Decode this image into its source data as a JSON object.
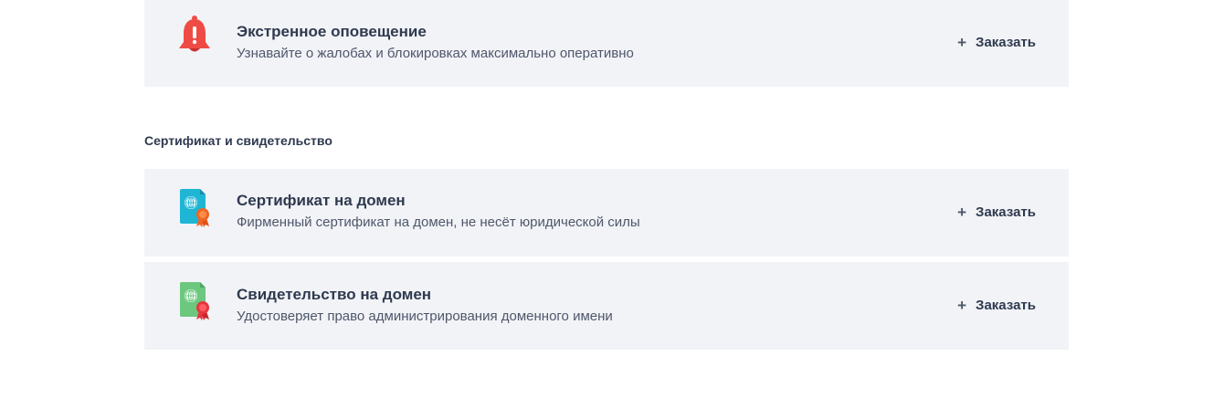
{
  "cards": [
    {
      "title": "Экстренное оповещение",
      "description": "Узнавайте о жалобах и блокировках максимально оперативно",
      "action_icon": "+",
      "action_label": "Заказать",
      "icon": "bell-alert-icon"
    }
  ],
  "section": {
    "title": "Сертификат и свидетельство",
    "items": [
      {
        "title": "Сертификат на домен",
        "description": "Фирменный сертификат на домен, не несёт юридической силы",
        "action_icon": "+",
        "action_label": "Заказать",
        "icon": "domain-certificate-icon"
      },
      {
        "title": "Свидетельство на домен",
        "description": "Удостоверяет право администрирования доменного имени",
        "action_icon": "+",
        "action_label": "Заказать",
        "icon": "domain-testimony-icon"
      }
    ]
  },
  "colors": {
    "card_bg": "#f2f3f7",
    "text": "#2f3a4f",
    "bell": "#ef4b45",
    "cert_blue": "#1eb6d4",
    "cert_green": "#6cc77f",
    "seal_orange": "#f26522",
    "seal_red": "#e8363f"
  }
}
